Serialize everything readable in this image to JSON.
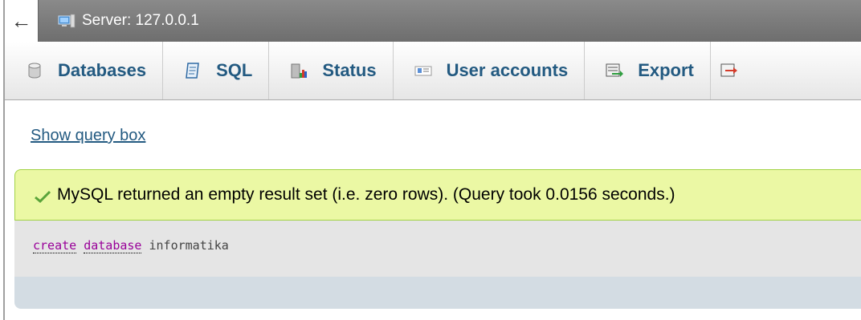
{
  "server_bar": {
    "back_symbol": "←",
    "title": "Server: 127.0.0.1",
    "icon": "server-icon"
  },
  "tabs": [
    {
      "label": "Databases",
      "icon": "database-icon"
    },
    {
      "label": "SQL",
      "icon": "sql-icon"
    },
    {
      "label": "Status",
      "icon": "status-icon"
    },
    {
      "label": "User accounts",
      "icon": "user-accounts-icon"
    },
    {
      "label": "Export",
      "icon": "export-icon"
    }
  ],
  "content": {
    "show_query_link": "Show query box",
    "success_message": "MySQL returned an empty result set (i.e. zero rows). (Query took 0.0156 seconds.)",
    "query": {
      "keyword1": "create",
      "keyword2": "database",
      "identifier": "informatika"
    }
  },
  "colors": {
    "link": "#235a81",
    "success_bg": "#ebf8a4",
    "success_border": "#a2d246",
    "sql_bg": "#e5e5e5",
    "keyword": "#990099"
  }
}
